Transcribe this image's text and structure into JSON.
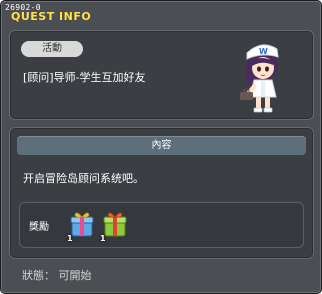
{
  "window": {
    "quest_id": "26902-0",
    "title": "QUEST INFO"
  },
  "quest": {
    "tag": "活動",
    "name": "[顾问]导师-学生互加好友"
  },
  "content": {
    "header": "內容",
    "description": "开启冒险岛顾问系统吧。"
  },
  "rewards": {
    "label": "獎勵",
    "items": [
      {
        "icon": "blue-gift-box-icon",
        "quantity": "1"
      },
      {
        "icon": "green-gift-box-icon",
        "quantity": "1"
      }
    ]
  },
  "status": {
    "text": "狀態： 可開始"
  },
  "colors": {
    "title": "#ffe14a",
    "panel": "#3b3e42",
    "header_bar": "#5d6f7a"
  }
}
